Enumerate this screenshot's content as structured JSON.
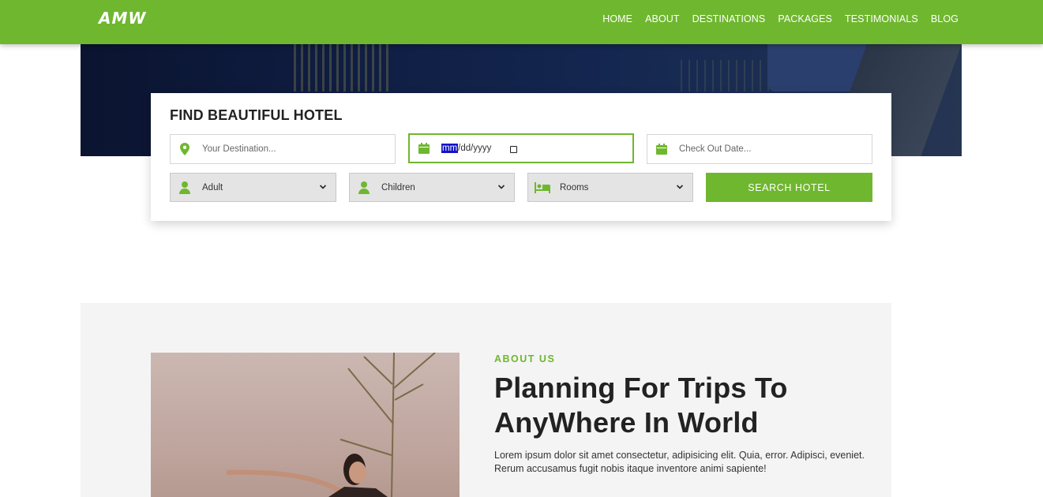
{
  "brand": "AMW",
  "nav": [
    "HOME",
    "ABOUT",
    "DESTINATIONS",
    "PACKAGES",
    "TESTIMONIALS",
    "BLOG"
  ],
  "search": {
    "title": "FIND BEAUTIFUL HOTEL",
    "destination_placeholder": "Your Destination...",
    "checkin_mm": "mm",
    "checkin_rest": "/dd/yyyy",
    "checkout_placeholder": "Check Out Date...",
    "adult": "Adult",
    "children": "Children",
    "rooms": "Rooms",
    "button": "SEARCH HOTEL"
  },
  "about": {
    "kicker": "ABOUT US",
    "heading": "Planning For Trips To AnyWhere In World",
    "body": "Lorem ipsum dolor sit amet consectetur, adipisicing elit. Quia, error. Adipisci, eveniet. Rerum accusamus fugit nobis itaque inventore animi sapiente!"
  },
  "colors": {
    "accent": "#6fb72f",
    "section_bg": "#f4f4f4"
  },
  "icons": [
    "map-marker-icon",
    "calendar-icon",
    "user-icon",
    "bed-icon",
    "chevron-down-icon"
  ]
}
